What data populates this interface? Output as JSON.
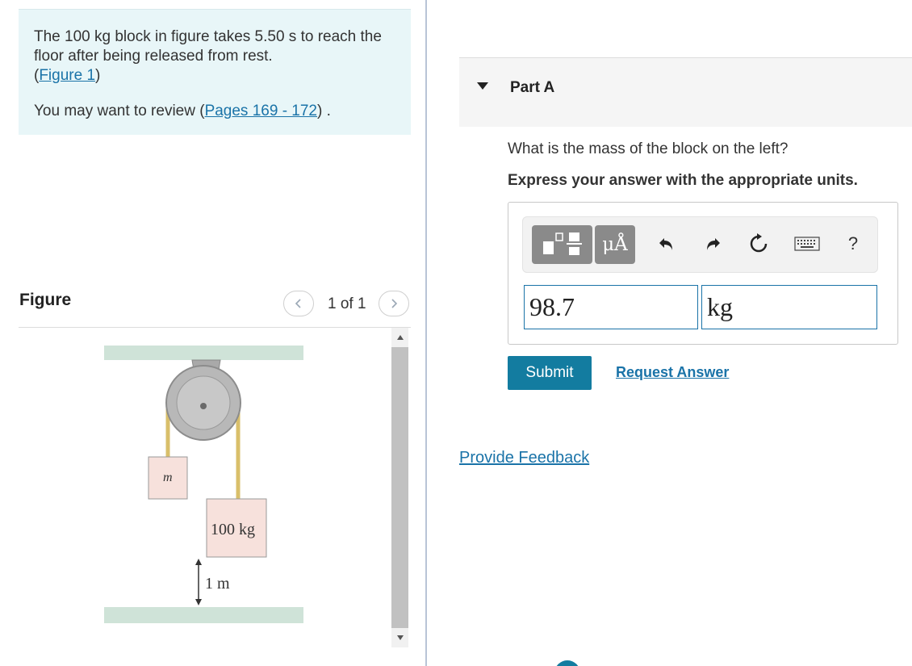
{
  "intro": {
    "problem_text": "The 100 kg block in figure takes 5.50 s to reach the floor after being released from rest.",
    "figure_link_open": "(",
    "figure_link": "Figure 1",
    "figure_link_close": ")",
    "review_prefix": "You may want to review (",
    "review_link": "Pages 169 - 172",
    "review_suffix": ") ."
  },
  "figure_panel": {
    "title": "Figure",
    "page_indicator": "1 of 1",
    "labels": {
      "left_block": "m",
      "right_block": "100 kg",
      "height": "1 m"
    },
    "colors": {
      "block": "#f7e1dc",
      "ground": "#cfe3d8",
      "pulley": "#b5b5b5",
      "rope": "#d9bf6a"
    }
  },
  "part": {
    "title": "Part A",
    "question": "What is the mass of the block on the left?",
    "instruction": "Express your answer with the appropriate units."
  },
  "toolbar": {
    "templates_icon": "templates-icon",
    "units_label": "μÅ",
    "undo_icon": "undo-icon",
    "redo_icon": "redo-icon",
    "reset_icon": "reset-icon",
    "keyboard_icon": "keyboard-icon",
    "help_label": "?"
  },
  "answer": {
    "value": "98.7",
    "unit": "kg"
  },
  "actions": {
    "submit_label": "Submit",
    "request_label": "Request Answer",
    "feedback_label": "Provide Feedback"
  },
  "colors": {
    "accent": "#137ca0",
    "link": "#1a73a8",
    "intro_bg": "#e8f6f8"
  }
}
